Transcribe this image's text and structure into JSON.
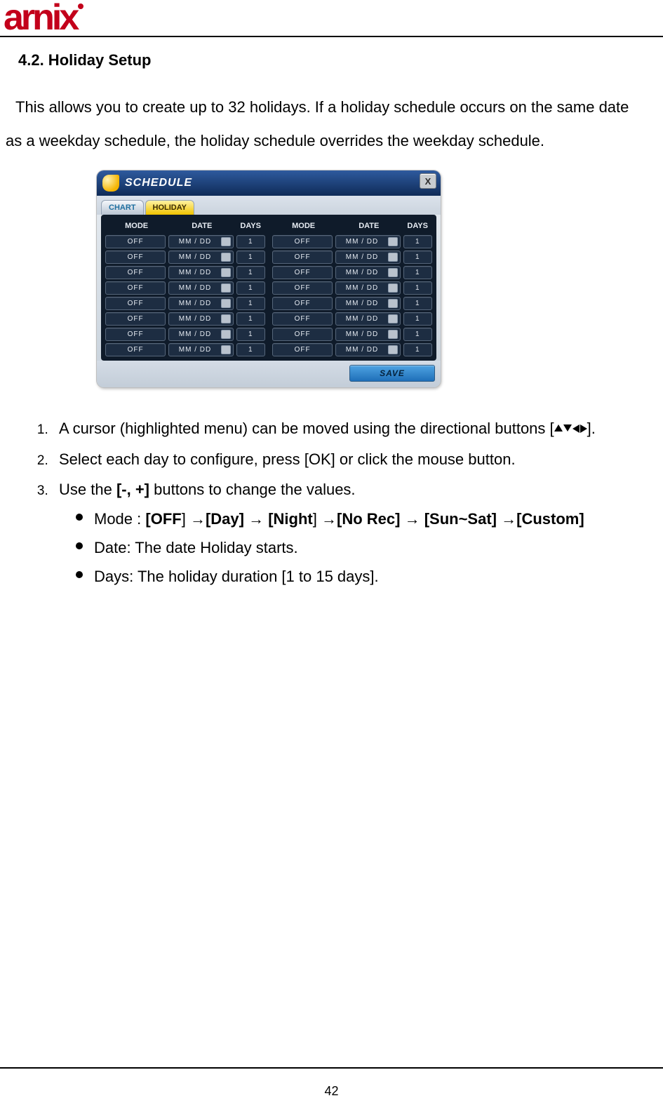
{
  "logo_text": "arnix",
  "section_title": "4.2.  Holiday  Setup",
  "intro_line1": "This allows you to create up to 32 holidays. If a holiday schedule occurs on the same date",
  "intro_line2": "as a weekday schedule, the holiday schedule overrides the weekday schedule.",
  "shot": {
    "title": "SCHEDULE",
    "close": "X",
    "tabs": {
      "chart": "CHART",
      "holiday": "HOLIDAY"
    },
    "headers": {
      "mode": "MODE",
      "date": "DATE",
      "days": "DAYS"
    },
    "cell": {
      "mode": "OFF",
      "date": "MM / DD",
      "days": "1"
    },
    "save": "SAVE"
  },
  "instr": {
    "i1a": "A cursor (highlighted menu) can be moved using the directional buttons [",
    "i1b": "].",
    "i2": "Select each day to configure, press [OK] or click the mouse button.",
    "i3a": "Use the ",
    "i3b": "[-, +]",
    "i3c": " buttons to change the values.",
    "s1_pre": "Mode : ",
    "s1_off": "[OFF",
    "s1_off_close": "]",
    "s1_arrow": " →",
    "s1_day": "[Day]",
    "s1_night": "[Night",
    "s1_night_close": "]",
    "s1_norec": "[No Rec]",
    "s1_sunsat": "[Sun~Sat]",
    "s1_custom": "[Custom]",
    "s2": "Date: The date Holiday starts.",
    "s3": "Days: The holiday duration [1 to 15 days]."
  },
  "page_number": "42"
}
